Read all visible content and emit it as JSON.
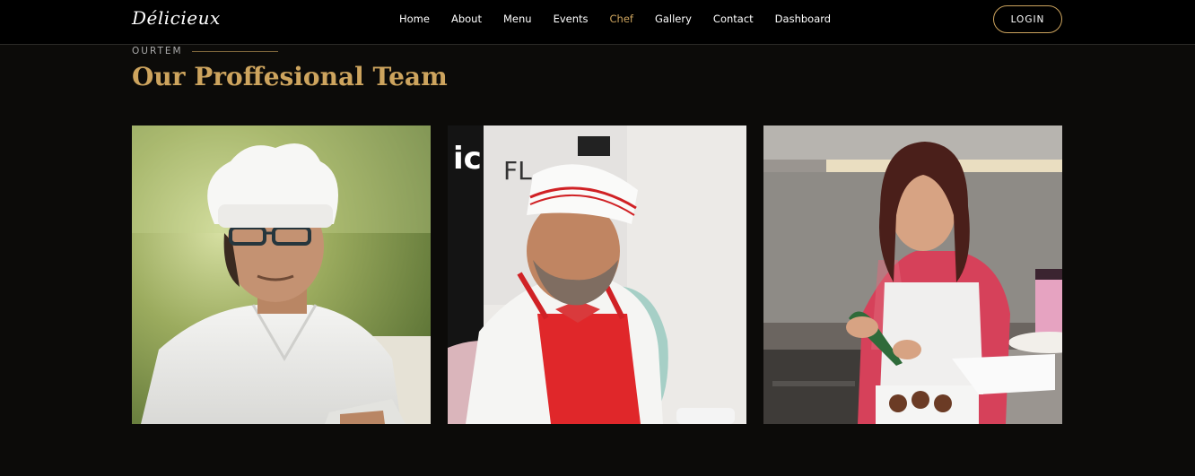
{
  "brand": {
    "logo_text": "Délicieux"
  },
  "nav": {
    "items": [
      {
        "label": "Home",
        "active": false
      },
      {
        "label": "About",
        "active": false
      },
      {
        "label": "Menu",
        "active": false
      },
      {
        "label": "Events",
        "active": false
      },
      {
        "label": "Chef",
        "active": true
      },
      {
        "label": "Gallery",
        "active": false
      },
      {
        "label": "Contact",
        "active": false
      },
      {
        "label": "Dashboard",
        "active": false
      }
    ],
    "login_label": "LOGIN"
  },
  "section": {
    "eyebrow": "OURTEM",
    "title": "Our Proffesional Team"
  },
  "team": [
    {
      "photo": "chef-portrait-glasses"
    },
    {
      "photo": "chef-red-apron-bowtie"
    },
    {
      "photo": "pastry-chef-decorating-cake"
    }
  ],
  "colors": {
    "accent": "#cda45e",
    "background": "#0c0b09",
    "header": "#000000"
  }
}
